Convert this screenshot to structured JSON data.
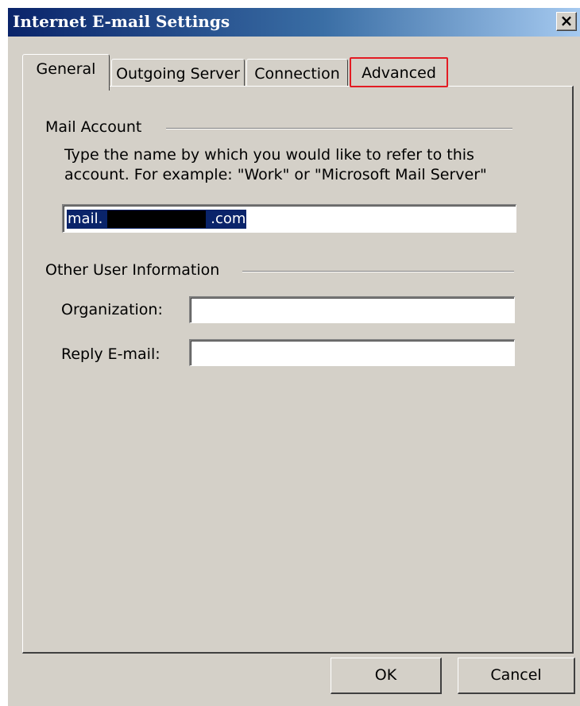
{
  "window": {
    "title": "Internet E-mail Settings",
    "close_glyph": "×"
  },
  "tabs": [
    {
      "label": "General",
      "active": true
    },
    {
      "label": "Outgoing Server",
      "active": false
    },
    {
      "label": "Connection",
      "active": false
    },
    {
      "label": "Advanced",
      "active": false,
      "highlighted": true,
      "highlight_color": "#e31b23"
    }
  ],
  "mail_account": {
    "heading": "Mail Account",
    "description_line1": "Type the name by which you would like to refer to this",
    "description_line2": "account.  For example: \"Work\" or \"Microsoft Mail Server\"",
    "value_prefix": "mail.",
    "value_suffix": ".com"
  },
  "other_user_info": {
    "heading": "Other User Information",
    "organization_label": "Organization:",
    "organization_value": "",
    "reply_email_label": "Reply E-mail:",
    "reply_email_value": ""
  },
  "buttons": {
    "ok": "OK",
    "cancel": "Cancel"
  },
  "colors": {
    "face": "#d4d0c8",
    "title_start": "#0a246a",
    "selection": "#0a246a"
  }
}
